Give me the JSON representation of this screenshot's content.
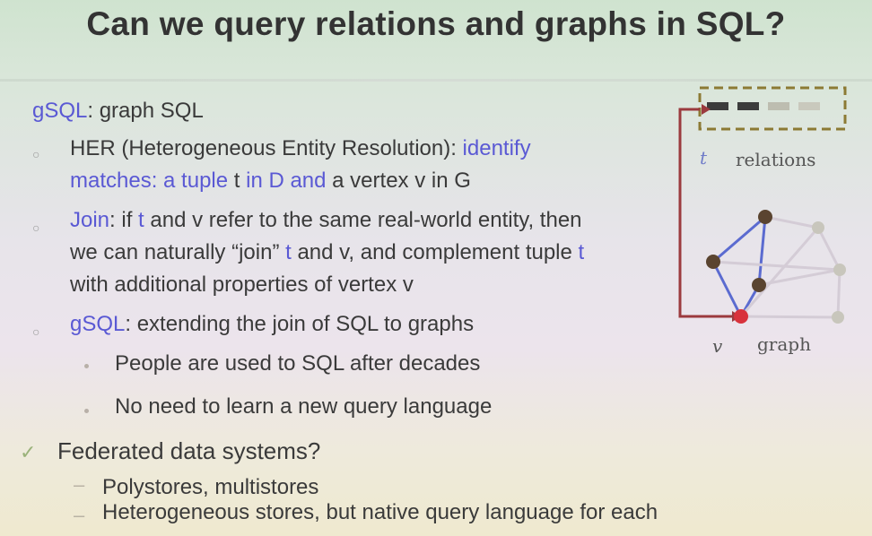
{
  "slide": {
    "title": "Can we query relations and graphs in SQL?",
    "heading": {
      "term": "gSQL",
      "rest": ": graph SQL"
    },
    "bullet_her": {
      "prefix": "HER (Heterogeneous Entity Resolution): ",
      "blue_line1": "identify",
      "blue_line2": "matches: a tuple ",
      "t": "t",
      "in_d": " in D and",
      "tail": " a vertex v in G"
    },
    "bullet_join": {
      "term": "Join",
      "line1_a": ": if ",
      "t1": "t",
      "line1_b": " and v refer to the same real-world entity, then",
      "line2_a": "we can naturally “join” ",
      "t2": "t",
      "line2_b": " and v, and complement tuple ",
      "t3": "t",
      "line3": "with additional properties of vertex v"
    },
    "bullet_gsql": {
      "term": "gSQL",
      "rest": ": extending the join of SQL to graphs",
      "sub1": "People are used to SQL after decades",
      "sub2": "No need to learn a new query language"
    },
    "federated": {
      "title": "Federated data systems?",
      "items": [
        "Polystores, multistores",
        "Heterogeneous stores, but native query language for each"
      ]
    }
  },
  "diagram": {
    "t_label": "t",
    "relations_label": "relations",
    "v_label": "v",
    "graph_label": "graph",
    "colors": {
      "arrow": "#9b3a3e",
      "dark_node": "#5a4430",
      "red_node": "#d8323c",
      "faded_node": "#c8c6bc",
      "tuple_box": "#8c7a34"
    }
  }
}
